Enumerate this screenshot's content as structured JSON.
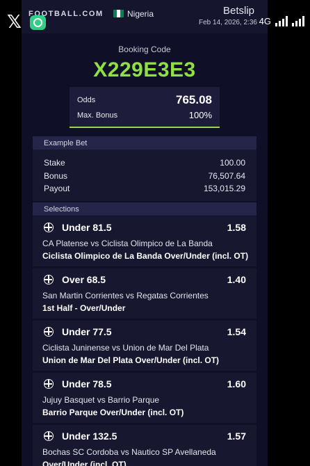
{
  "status_bar": {
    "app_icon": "x-logo",
    "network": "4G",
    "signal_icon": "signal-bars-icon"
  },
  "header": {
    "brand": "FOOTBALL.COM",
    "country": "Nigeria",
    "flag_colors": [
      "#008751",
      "#ffffff",
      "#008751"
    ],
    "title": "Betslip",
    "date": "Feb 14, 2026, 2:36"
  },
  "booking": {
    "label": "Booking Code",
    "code": "X229E3E3"
  },
  "odds_summary": {
    "odds_label": "Odds",
    "odds_value": "765.08",
    "bonus_label": "Max. Bonus",
    "bonus_value": "100%"
  },
  "example_bet": {
    "heading": "Example Bet",
    "rows": [
      {
        "label": "Stake",
        "value": "100.00"
      },
      {
        "label": "Bonus",
        "value": "76,507.64"
      },
      {
        "label": "Payout",
        "value": "153,015.29"
      }
    ]
  },
  "selections": {
    "heading": "Selections",
    "items": [
      {
        "pick": "Under 81.5",
        "odds": "1.58",
        "match": "CA Platense vs Ciclista Olimpico de La Banda",
        "market": "Ciclista Olimpico de La Banda Over/Under (incl. OT)"
      },
      {
        "pick": "Over 68.5",
        "odds": "1.40",
        "match": "San Martin Corrientes vs Regatas Corrientes",
        "market": "1st Half - Over/Under"
      },
      {
        "pick": "Under 77.5",
        "odds": "1.54",
        "match": "Ciclista Juninense vs Union de Mar Del Plata",
        "market": "Union de Mar Del Plata Over/Under (incl. OT)"
      },
      {
        "pick": "Under 78.5",
        "odds": "1.60",
        "match": "Jujuy Basquet vs Barrio Parque",
        "market": "Barrio Parque Over/Under (incl. OT)"
      },
      {
        "pick": "Under 132.5",
        "odds": "1.57",
        "match": "Bochas SC Cordoba vs Nautico SP Avellaneda",
        "market": "Over/Under (incl. OT)"
      }
    ]
  },
  "colors": {
    "accent": "#8ee044",
    "background": "#0f0f27",
    "section_header": "#25254a"
  }
}
